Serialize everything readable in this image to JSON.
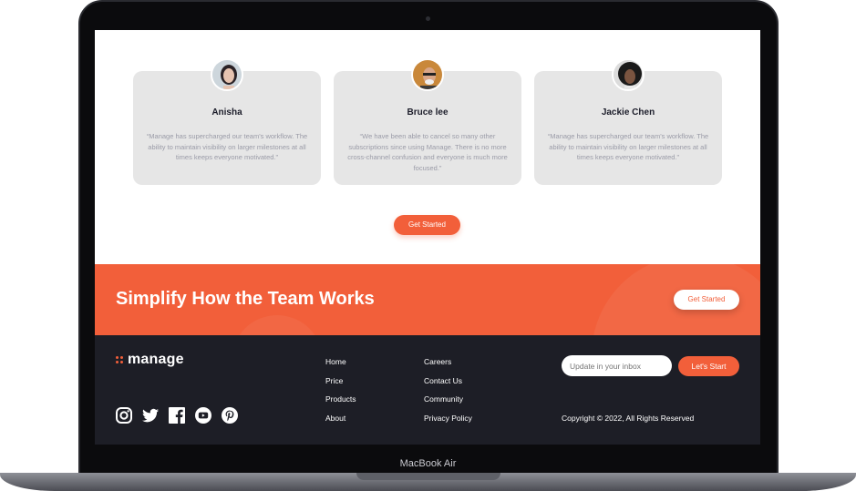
{
  "device_label": "MacBook Air",
  "testimonials": [
    {
      "name": "Anisha",
      "quote": "“Manage has supercharged our team's workflow. The ability to maintain visibility on larger milestones at all times keeps everyone motivated.”"
    },
    {
      "name": "Bruce lee",
      "quote": "“We have been able to cancel so many other subscriptions since using Manage. There is no more cross-channel confusion and everyone is much more focused.”"
    },
    {
      "name": "Jackie Chen",
      "quote": "“Manage has supercharged our team's workflow. The ability to maintain visibility on larger milestones at all times keeps everyone motivated.”"
    }
  ],
  "cta_label": "Get Started",
  "band": {
    "title": "Simplify How the Team Works",
    "button_label": "Get Started"
  },
  "footer": {
    "logo_text": "manage",
    "links_col1": [
      "Home",
      "Price",
      "Products",
      "About"
    ],
    "links_col2": [
      "Careers",
      "Contact Us",
      "Community",
      "Privacy Policy"
    ],
    "inbox_placeholder": "Update in your inbox",
    "submit_label": "Let's Start",
    "copyright": "Copyright © 2022, All Rights Reserved",
    "socials": [
      "instagram-icon",
      "twitter-icon",
      "facebook-icon",
      "youtube-icon",
      "pinterest-icon"
    ]
  },
  "colors": {
    "accent": "#f25f3a",
    "footer_bg": "#1d1e26",
    "card_bg": "#e6e6e6"
  }
}
